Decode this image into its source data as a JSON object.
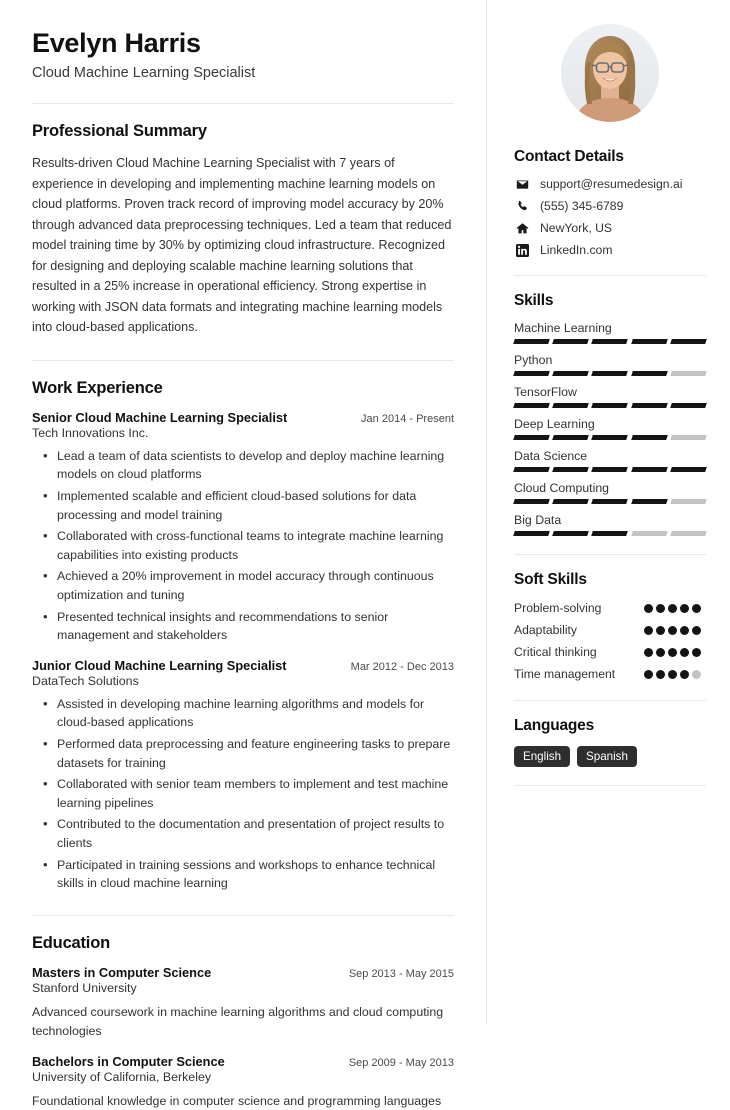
{
  "header": {
    "name": "Evelyn Harris",
    "job_title": "Cloud Machine Learning Specialist"
  },
  "summary": {
    "heading": "Professional Summary",
    "text": "Results-driven Cloud Machine Learning Specialist with 7 years of experience in developing and implementing machine learning models on cloud platforms. Proven track record of improving model accuracy by 20% through advanced data preprocessing techniques. Led a team that reduced model training time by 30% by optimizing cloud infrastructure. Recognized for designing and deploying scalable machine learning solutions that resulted in a 25% increase in operational efficiency. Strong expertise in working with JSON data formats and integrating machine learning models into cloud-based applications."
  },
  "work": {
    "heading": "Work Experience",
    "entries": [
      {
        "role": "Senior Cloud Machine Learning Specialist",
        "date": "Jan 2014 - Present",
        "org": "Tech Innovations Inc.",
        "bullets": [
          "Lead a team of data scientists to develop and deploy machine learning models on cloud platforms",
          "Implemented scalable and efficient cloud-based solutions for data processing and model training",
          "Collaborated with cross-functional teams to integrate machine learning capabilities into existing products",
          "Achieved a 20% improvement in model accuracy through continuous optimization and tuning",
          "Presented technical insights and recommendations to senior management and stakeholders"
        ]
      },
      {
        "role": "Junior Cloud Machine Learning Specialist",
        "date": "Mar 2012 - Dec 2013",
        "org": "DataTech Solutions",
        "bullets": [
          "Assisted in developing machine learning algorithms and models for cloud-based applications",
          "Performed data preprocessing and feature engineering tasks to prepare datasets for training",
          "Collaborated with senior team members to implement and test machine learning pipelines",
          "Contributed to the documentation and presentation of project results to clients",
          "Participated in training sessions and workshops to enhance technical skills in cloud machine learning"
        ]
      }
    ]
  },
  "education": {
    "heading": "Education",
    "entries": [
      {
        "degree": "Masters in Computer Science",
        "date": "Sep 2013 - May 2015",
        "school": "Stanford University",
        "description": "Advanced coursework in machine learning algorithms and cloud computing technologies"
      },
      {
        "degree": "Bachelors in Computer Science",
        "date": "Sep 2009 - May 2013",
        "school": "University of California, Berkeley",
        "description": "Foundational knowledge in computer science and programming languages"
      }
    ]
  },
  "contact": {
    "heading": "Contact Details",
    "items": [
      {
        "icon": "envelope-icon",
        "value": "support@resumedesign.ai"
      },
      {
        "icon": "phone-icon",
        "value": "(555) 345-6789"
      },
      {
        "icon": "home-icon",
        "value": "NewYork, US"
      },
      {
        "icon": "linkedin-icon",
        "value": "LinkedIn.com"
      }
    ]
  },
  "skills": {
    "heading": "Skills",
    "max_level": 5,
    "items": [
      {
        "name": "Machine Learning",
        "level": 5
      },
      {
        "name": "Python",
        "level": 4
      },
      {
        "name": "TensorFlow",
        "level": 5
      },
      {
        "name": "Deep Learning",
        "level": 4
      },
      {
        "name": "Data Science",
        "level": 5
      },
      {
        "name": "Cloud Computing",
        "level": 4
      },
      {
        "name": "Big Data",
        "level": 3
      }
    ]
  },
  "soft_skills": {
    "heading": "Soft Skills",
    "max_level": 5,
    "items": [
      {
        "name": "Problem-solving",
        "level": 5
      },
      {
        "name": "Adaptability",
        "level": 5
      },
      {
        "name": "Critical thinking",
        "level": 5
      },
      {
        "name": "Time management",
        "level": 4
      }
    ]
  },
  "languages": {
    "heading": "Languages",
    "items": [
      "English",
      "Spanish"
    ]
  },
  "colors": {
    "accent": "#141414",
    "muted": "#c3c3c3",
    "divider": "#e9e9e9",
    "tag_bg": "#2e2e2e"
  }
}
